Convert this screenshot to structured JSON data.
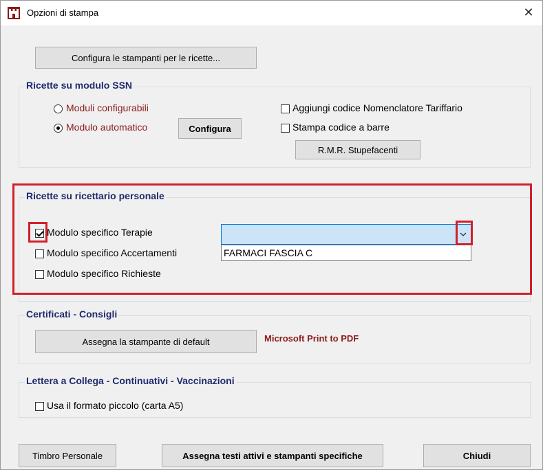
{
  "window": {
    "title": "Opzioni di stampa",
    "close_glyph": "✕",
    "app_icon": "castle-icon"
  },
  "top_button": "Configura le stampanti per le ricette...",
  "ssn": {
    "title": "Ricette su modulo SSN",
    "radio_configurabili": "Moduli configurabili",
    "radio_automatico": "Modulo automatico",
    "configura_button": "Configura",
    "chk_nomenclatore": "Aggiungi codice Nomenclatore Tariffario",
    "chk_barcode": "Stampa codice a barre",
    "rmr_button": "R.M.R. Stupefacenti"
  },
  "personale": {
    "title": "Ricette su ricettario personale",
    "chk_terapie": "Modulo specifico Terapie",
    "chk_accertamenti": "Modulo specifico Accertamenti",
    "chk_richieste": "Modulo specifico Richieste",
    "combo_value": "",
    "dropdown_options": [
      "FARMACI FASCIA C"
    ]
  },
  "certificati": {
    "title": "Certificati - Consigli",
    "assign_button": "Assegna la stampante di default",
    "printer": "Microsoft Print to PDF"
  },
  "lettera": {
    "title": "Lettera a Collega - Continuativi - Vaccinazioni",
    "chk_a5": "Usa il formato piccolo (carta A5)"
  },
  "footer": {
    "timbro": "Timbro Personale",
    "assegna_testi": "Assegna testi attivi e stampanti specifiche",
    "chiudi": "Chiudi"
  },
  "colors": {
    "highlight": "#d0202a",
    "group_title": "#1f2a6e",
    "label_red": "#8b1a1a",
    "combo_bg": "#cce4f7"
  }
}
